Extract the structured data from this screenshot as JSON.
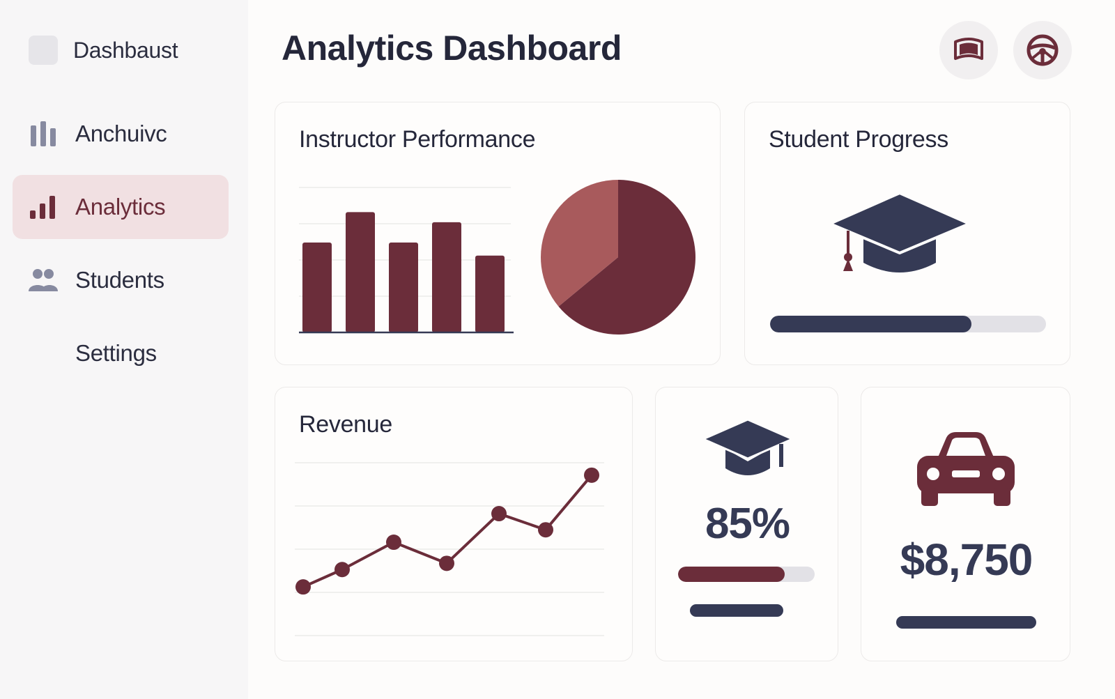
{
  "app": {
    "title": "Analytics Dashboard"
  },
  "sidebar": {
    "brand": {
      "label": "Dashbaust"
    },
    "items": [
      {
        "label": "Anchuivc",
        "icon": "bar-columns-icon",
        "active": false
      },
      {
        "label": "Analytics",
        "icon": "bar-chart-icon",
        "active": true
      },
      {
        "label": "Students",
        "icon": "users-icon",
        "active": false
      },
      {
        "label": "Settings",
        "icon": "",
        "active": false
      }
    ]
  },
  "header": {
    "actions": [
      {
        "icon": "flag-icon"
      },
      {
        "icon": "steering-wheel-icon"
      }
    ]
  },
  "colors": {
    "accent": "#6b2d3a",
    "accent_light": "#a85a5c",
    "navy": "#353a55",
    "active_bg": "#f1e0e2",
    "track": "#e2e1e6"
  },
  "cards": {
    "instructor_performance": {
      "title": "Instructor Performance"
    },
    "student_progress": {
      "title": "Student Progress",
      "icon": "graduation-cap-icon",
      "progress": 0.73
    },
    "revenue": {
      "title": "Revenue"
    },
    "pass_rate": {
      "icon": "graduation-cap-icon",
      "value": "85%",
      "progress": 0.78
    },
    "earnings": {
      "icon": "car-icon",
      "value": "$8,750"
    }
  },
  "chart_data": [
    {
      "type": "bar",
      "categories": [
        "",
        "",
        "",
        "",
        ""
      ],
      "values": [
        62,
        83,
        62,
        76,
        53
      ],
      "ylim": [
        0,
        100
      ],
      "grid": true,
      "color": "#6b2d3a"
    },
    {
      "type": "pie",
      "values": [
        64,
        36
      ],
      "colors": [
        "#6b2d3a",
        "#a85a5c"
      ]
    },
    {
      "type": "line",
      "x": [
        1,
        2,
        3,
        4,
        5,
        6,
        7
      ],
      "values": [
        10,
        24,
        46,
        29,
        69,
        56,
        100
      ],
      "ylim": [
        0,
        110
      ],
      "grid": true,
      "color": "#6b2d3a"
    }
  ]
}
